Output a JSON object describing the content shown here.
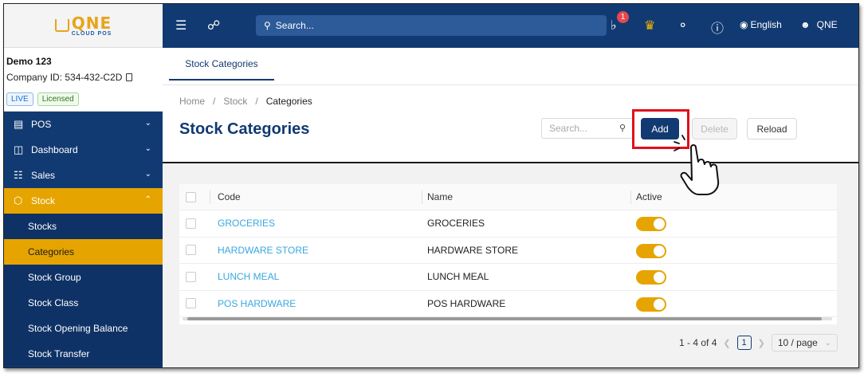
{
  "logo": {
    "main": "QNE",
    "sub": "CLOUD POS"
  },
  "company": {
    "name": "Demo 123",
    "id": "Company ID: 534-432-C2D",
    "badges": {
      "live": "LIVE",
      "licensed": "Licensed"
    }
  },
  "sidebar": {
    "items": [
      {
        "label": "POS",
        "icon": "pos-register-icon"
      },
      {
        "label": "Dashboard",
        "icon": "dashboard-monitor-icon"
      },
      {
        "label": "Sales",
        "icon": "sales-barcode-icon"
      },
      {
        "label": "Stock",
        "icon": "stock-box-icon"
      }
    ],
    "stock_submenu": [
      "Stocks",
      "Categories",
      "Stock Group",
      "Stock Class",
      "Stock Opening Balance",
      "Stock Transfer"
    ]
  },
  "topbar": {
    "search_placeholder": "Search...",
    "notification_count": "1",
    "language": "English",
    "user": "QNE"
  },
  "tab": {
    "label": "Stock Categories"
  },
  "breadcrumb": {
    "home": "Home",
    "sep": "/",
    "stock": "Stock",
    "current": "Categories"
  },
  "page": {
    "title": "Stock Categories"
  },
  "toolbar": {
    "search_placeholder": "Search...",
    "add_label": "Add",
    "delete_label": "Delete",
    "reload_label": "Reload"
  },
  "table": {
    "headers": {
      "code": "Code",
      "name": "Name",
      "active": "Active"
    },
    "rows": [
      {
        "code": "GROCERIES",
        "name": "GROCERIES",
        "active": true
      },
      {
        "code": "HARDWARE STORE",
        "name": "HARDWARE STORE",
        "active": true
      },
      {
        "code": "LUNCH MEAL",
        "name": "LUNCH MEAL",
        "active": true
      },
      {
        "code": "POS HARDWARE",
        "name": "POS HARDWARE",
        "active": true
      }
    ]
  },
  "pagination": {
    "range": "1 - 4 of 4",
    "current": "1",
    "page_size": "10 / page"
  },
  "colors": {
    "primary": "#123a72",
    "accent": "#e6a400",
    "link": "#3aa7e0",
    "highlight": "#e0101a"
  }
}
